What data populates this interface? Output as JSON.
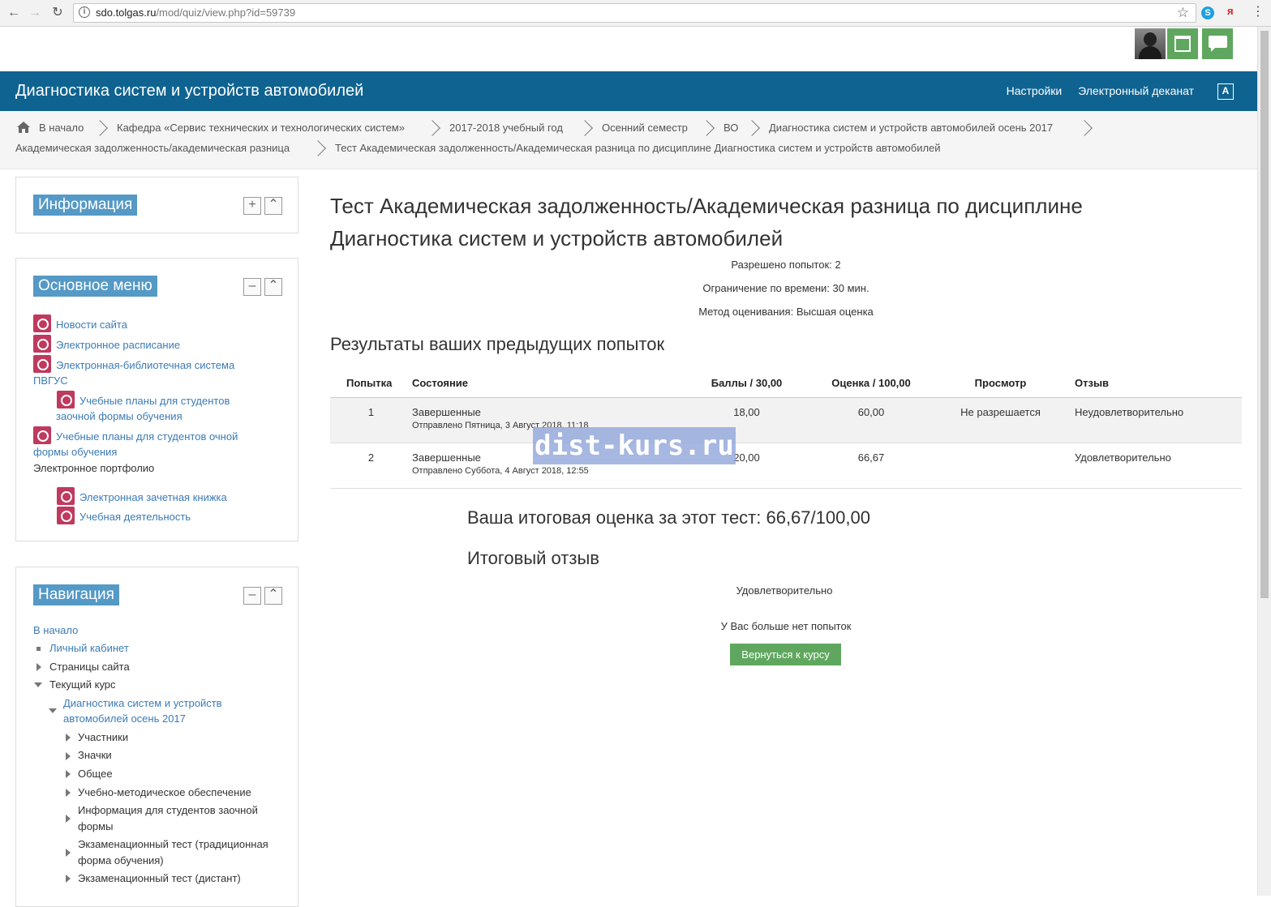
{
  "browser": {
    "url_host": "sdo.tolgas.ru",
    "url_path": "/mod/quiz/view.php?id=59739"
  },
  "header": {
    "site_title": "Диагностика систем и устройств автомобилей",
    "nav": [
      "Настройки",
      "Электронный деканат"
    ]
  },
  "breadcrumb": [
    "В начало",
    "Кафедра «Сервис технических и технологических систем»",
    "2017-2018 учебный год",
    "Осенний семестр",
    "ВО",
    "Диагностика систем и устройств автомобилей осень 2017",
    "Академическая задолженность/академическая разница",
    "Тест Академическая задолженность/Академическая разница по дисциплине Диагностика систем и устройств автомобилей"
  ],
  "blocks": {
    "info": {
      "title": "Информация"
    },
    "main_menu": {
      "title": "Основное меню",
      "items": [
        "Новости сайта",
        "Электронное расписание",
        "Электронная-библиотечная система",
        "ПВГУС",
        "Учебные планы для студентов",
        "заочной формы обучения",
        "Учебные планы для студентов очной",
        "формы обучения",
        "Электронное портфолио",
        "Электронная зачетная книжка",
        "Учебная деятельность"
      ]
    },
    "navigation": {
      "title": "Навигация",
      "items": [
        "В начало",
        "Личный кабинет",
        "Страницы сайта",
        "Текущий курс",
        "Диагностика систем и устройств",
        "автомобилей осень 2017",
        "Участники",
        "Значки",
        "Общее",
        "Учебно-методическое обеспечение",
        "Информация для студентов заочной",
        "формы",
        "Экзаменационный тест (традиционная",
        "форма обучения)",
        "Экзаменационный тест (дистант)"
      ]
    }
  },
  "quiz": {
    "title_line1": "Тест Академическая задолженность/Академическая разница по дисциплине",
    "title_line2": "Диагностика систем и устройств автомобилей",
    "info": [
      "Разрешено попыток: 2",
      "Ограничение по времени: 30 мин.",
      "Метод оценивания: Высшая оценка"
    ],
    "results_heading": "Результаты ваших предыдущих попыток",
    "columns": [
      "Попытка",
      "Состояние",
      "Баллы / 30,00",
      "Оценка / 100,00",
      "Просмотр",
      "Отзыв"
    ],
    "rows": [
      {
        "attempt": "1",
        "state": "Завершенные",
        "submitted": "Отправлено Пятница, 3 Август 2018, 11:18",
        "marks": "18,00",
        "grade": "60,00",
        "review": "Не разрешается",
        "feedback": "Неудовлетворительно"
      },
      {
        "attempt": "2",
        "state": "Завершенные",
        "submitted": "Отправлено Суббота, 4 Август 2018, 12:55",
        "marks": "20,00",
        "grade": "66,67",
        "review": "",
        "feedback": "Удовлетворительно"
      }
    ],
    "final_grade": "Ваша итоговая оценка за этот тест: 66,67/100,00",
    "final_feedback_heading": "Итоговый отзыв",
    "final_feedback": "Удовлетворительно",
    "no_more": "У Вас больше нет попыток",
    "back_button": "Вернуться к курсу"
  },
  "watermark": "dist-kurs.ru",
  "colors": {
    "header_band": "#0f6391",
    "block_title": "#5599c6",
    "button_green": "#5fa75f",
    "link": "#3b7bb7"
  }
}
